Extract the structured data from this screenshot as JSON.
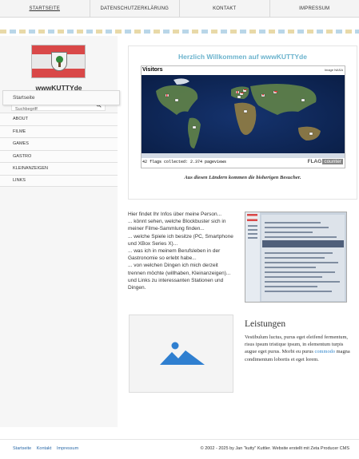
{
  "nav": {
    "items": [
      {
        "label": "STARTSEITE",
        "active": true
      },
      {
        "label": "DATENSCHUTZERKLÄRUNG",
        "active": false
      },
      {
        "label": "KONTAKT",
        "active": false
      },
      {
        "label": "IMPRESSUM",
        "active": false
      }
    ]
  },
  "sidebar": {
    "site_name": "wwwKUTTYde",
    "search": {
      "placeholder": "Suchbegriff",
      "icon": "search-icon"
    },
    "home_label": "Startseite",
    "menu": [
      "ABOUT",
      "FILME",
      "GAMES",
      "GASTRO",
      "KLEINANZEIGEN",
      "LINKS"
    ]
  },
  "welcome": {
    "title": "Herzlich Willkommen auf wwwKUTTYde",
    "widget_title": "Visitors",
    "image_credit": "Image NASA",
    "flags_text": "42 flags collected: 2.374 pageviews",
    "counter_brand": "FLAG",
    "counter_word": "counter",
    "caption": "Aus diesen Ländern kommen die bisherigen Besucher."
  },
  "intro": {
    "lines": [
      "Hier findet Ihr Infos über meine Person...",
      "... könnt sehen, welche Blockbuster sich in meiner Filme-Sammlung finden...",
      "... welche Spiele ich besitze (PC, Smartphone und XBox Series X)...",
      "... was ich in meinem Berufsleben in der Gastronomie so erlebt habe...",
      "... von welchen Dingen ich mich derzeit trennen möchte (willhaben, Kleinanzeigen)... und Links zu interessanten Stationen und Dingen."
    ]
  },
  "leistungen": {
    "title": "Leistungen",
    "text_before": "Vestibulum luctus, purus eget eleifend fermentum, risus ipsum tristique ipsum, in elementum turpis augue eget purus. Morbi eu purus ",
    "link": "commodo",
    "text_after": " magna condimentum lobortis et eget lorem."
  },
  "footer": {
    "links": [
      "Startseite",
      "Kontakt",
      "Impressum"
    ],
    "copyright": "© 2002 - 2025 by Jan \"kutty\" Kuttler. Website erstellt mit Zeta Producer CMS"
  },
  "colors": {
    "accent_title": "#6bb3cd",
    "link": "#2b6aa8",
    "map_ocean": "#0a1e46",
    "placeholder_icon": "#2f7fd0"
  }
}
